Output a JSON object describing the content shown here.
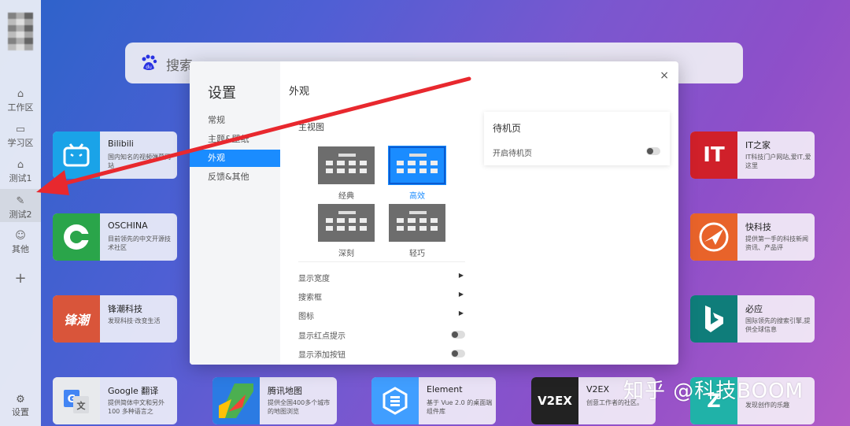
{
  "sidebar": {
    "items": [
      {
        "label": "工作区",
        "icon": "home-icon"
      },
      {
        "label": "学习区",
        "icon": "folder-icon"
      },
      {
        "label": "测试1",
        "icon": "home-icon"
      },
      {
        "label": "测试2",
        "icon": "wrench-icon"
      },
      {
        "label": "其他",
        "icon": "smile-icon"
      }
    ],
    "add": "+",
    "settings": "设置"
  },
  "search": {
    "placeholder": "搜索"
  },
  "tiles": {
    "bilibili": {
      "name": "Bilibili",
      "desc": "国内知名的视频弹幕网站",
      "color": "#1aa3e8"
    },
    "oschina": {
      "name": "OSCHINA",
      "desc": "目前领先的中文开源技术社区",
      "color": "#2aa54a"
    },
    "fengchao": {
      "name": "锋潮科技",
      "desc": "发现科技·改变生活",
      "color": "#d9553a",
      "logo": "锋潮"
    },
    "google": {
      "name": "Google 翻译",
      "desc": "提供简体中文和另外 100 多种语言之",
      "color": "#4285f4"
    },
    "tencentmap": {
      "name": "腾讯地图",
      "desc": "提供全国400多个城市的地图浏览",
      "color": "#2b7be3"
    },
    "element": {
      "name": "Element",
      "desc": "基于 Vue 2.0 的桌面端组件库",
      "color": "#409eff"
    },
    "v2ex": {
      "name": "V2EX",
      "desc": "创意工作者的社区。",
      "color": "#222222",
      "logo": "V2EX"
    },
    "ithome": {
      "name": "IT之家",
      "desc": "IT科技门户网站,爱IT,爱这里",
      "color": "#d0202a",
      "logo": "IT"
    },
    "kuaikeji": {
      "name": "快科技",
      "desc": "提供第一手的科技新闻资讯、产品评",
      "color": "#e8632a"
    },
    "bing": {
      "name": "必应",
      "desc": "国际领先的搜索引擎,提供全球信息",
      "color": "#0f7d7a"
    },
    "zhihu_like": {
      "name": "",
      "desc": "发现创作的乐趣",
      "color": "#20b2a8"
    }
  },
  "modal": {
    "title": "设置",
    "menu": [
      "常规",
      "主题&壁纸",
      "外观",
      "反馈&其他"
    ],
    "active_menu": "外观",
    "section": "外观",
    "close": "×",
    "main_view": "主视图",
    "views": [
      "经典",
      "高效",
      "深刻",
      "轻巧"
    ],
    "selected_view": "高效",
    "settings": [
      {
        "label": "显示宽度",
        "type": "arrow"
      },
      {
        "label": "搜索框",
        "type": "arrow"
      },
      {
        "label": "图标",
        "type": "arrow"
      },
      {
        "label": "显示红点提示",
        "type": "toggle"
      },
      {
        "label": "显示添加按钮",
        "type": "toggle"
      }
    ],
    "standby": {
      "title": "待机页",
      "option": "开启待机页"
    }
  },
  "watermark": "知乎 @科技BOOM",
  "colors": {
    "accent": "#1a8cff",
    "arrow": "#e8282e"
  }
}
